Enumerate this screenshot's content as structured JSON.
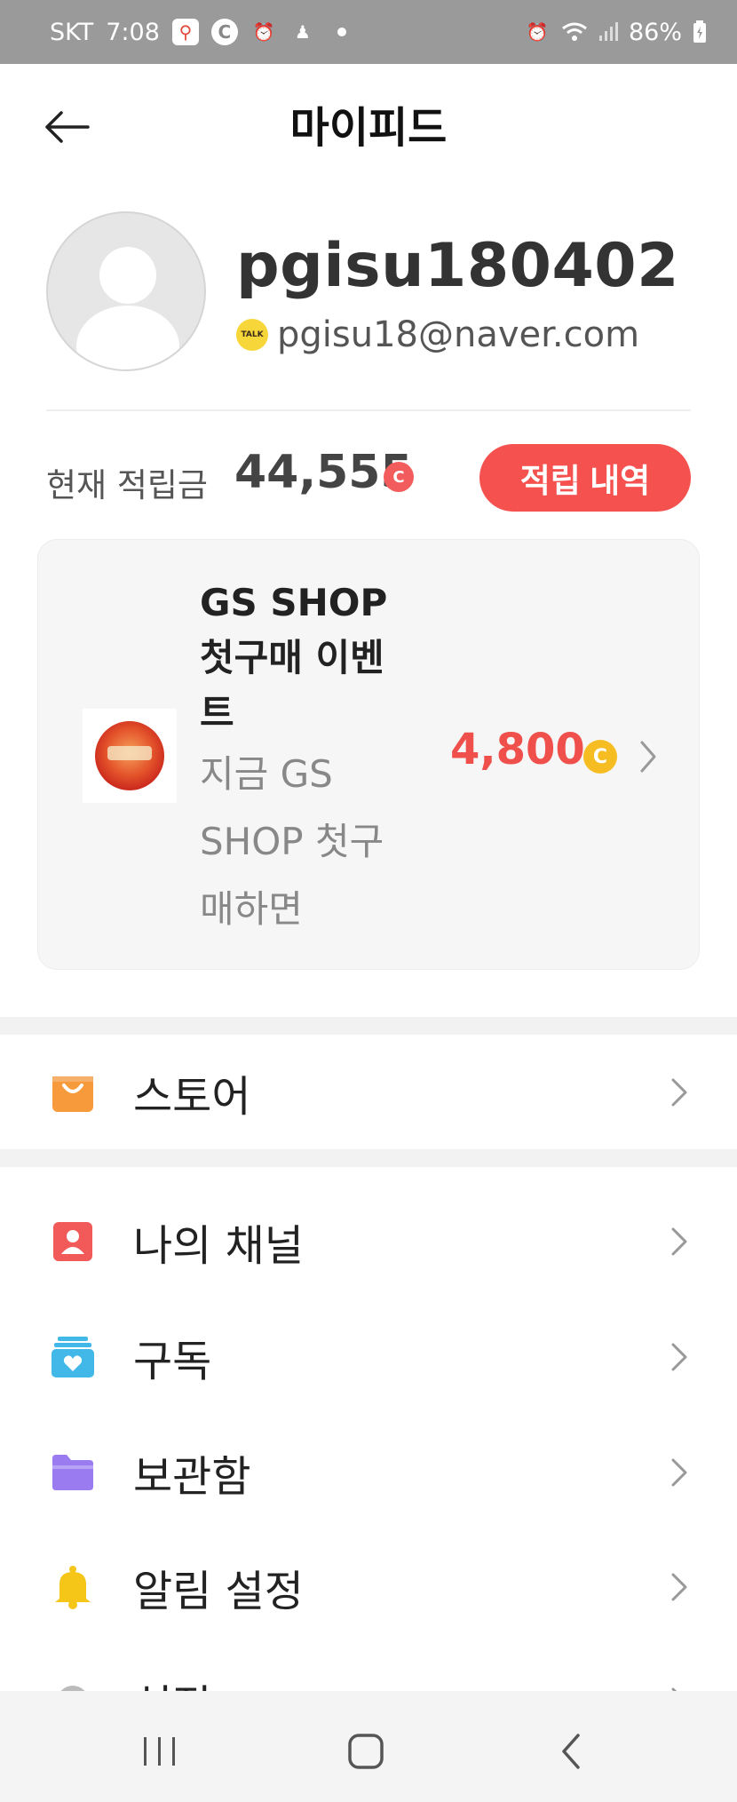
{
  "status_bar": {
    "carrier": "SKT",
    "time": "7:08",
    "battery": "86%",
    "icons": [
      "map-icon",
      "c-icon",
      "alarm-icon",
      "person-icon",
      "dot-icon",
      "alarm-icon",
      "wifi-icon",
      "signal-icon",
      "battery-icon"
    ]
  },
  "header": {
    "title": "마이피드",
    "back_icon": "arrow-left-icon"
  },
  "profile": {
    "username": "pgisu180402",
    "talk_badge": "TALK",
    "email": "pgisu18@naver.com"
  },
  "points": {
    "label": "현재 적립금",
    "value": "44,555",
    "coin_symbol": "C",
    "history_button": "적립 내역"
  },
  "event": {
    "title": "GS SHOP 첫구매 이벤트",
    "description": "지금 GS SHOP 첫구매하면",
    "amount": "4,800",
    "coin_symbol": "C"
  },
  "menu": {
    "store": "스토어",
    "items": [
      {
        "label": "나의 채널",
        "icon": "person-card-icon",
        "color": "#f25a5a"
      },
      {
        "label": "구독",
        "icon": "subscription-icon",
        "color": "#41b8e8"
      },
      {
        "label": "보관함",
        "icon": "folder-icon",
        "color": "#9a7cf0"
      },
      {
        "label": "알림 설정",
        "icon": "bell-icon",
        "color": "#f5c518"
      },
      {
        "label": "설정",
        "icon": "gear-icon",
        "color": "#bbbbbb"
      }
    ]
  },
  "colors": {
    "accent_red": "#f4514f",
    "coin_yellow": "#f5bd22",
    "store_orange": "#f79a3c"
  }
}
